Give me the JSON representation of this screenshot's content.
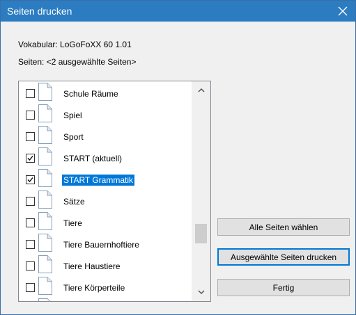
{
  "window": {
    "title": "Seiten drucken"
  },
  "info": {
    "vocabulary": "Vokabular: LoGoFoXX 60 1.01",
    "pages": "Seiten: <2 ausgewählte Seiten>"
  },
  "pages_list": [
    {
      "label": "Schule Räume",
      "checked": false,
      "selected": false
    },
    {
      "label": "Spiel",
      "checked": false,
      "selected": false
    },
    {
      "label": "Sport",
      "checked": false,
      "selected": false
    },
    {
      "label": "START (aktuell)",
      "checked": true,
      "selected": false
    },
    {
      "label": "START Grammatik",
      "checked": true,
      "selected": true
    },
    {
      "label": "Sätze",
      "checked": false,
      "selected": false
    },
    {
      "label": "Tiere",
      "checked": false,
      "selected": false
    },
    {
      "label": "Tiere Bauernhoftiere",
      "checked": false,
      "selected": false
    },
    {
      "label": "Tiere Haustiere",
      "checked": false,
      "selected": false
    },
    {
      "label": "Tiere Körperteile",
      "checked": false,
      "selected": false
    }
  ],
  "buttons": {
    "select_all": "Alle Seiten wählen",
    "print_selected": "Ausgewählte Seiten drucken",
    "done": "Fertig"
  },
  "colors": {
    "title_bar": "#2b7cc1",
    "selection": "#0078d7",
    "default_border": "#0078d7"
  }
}
